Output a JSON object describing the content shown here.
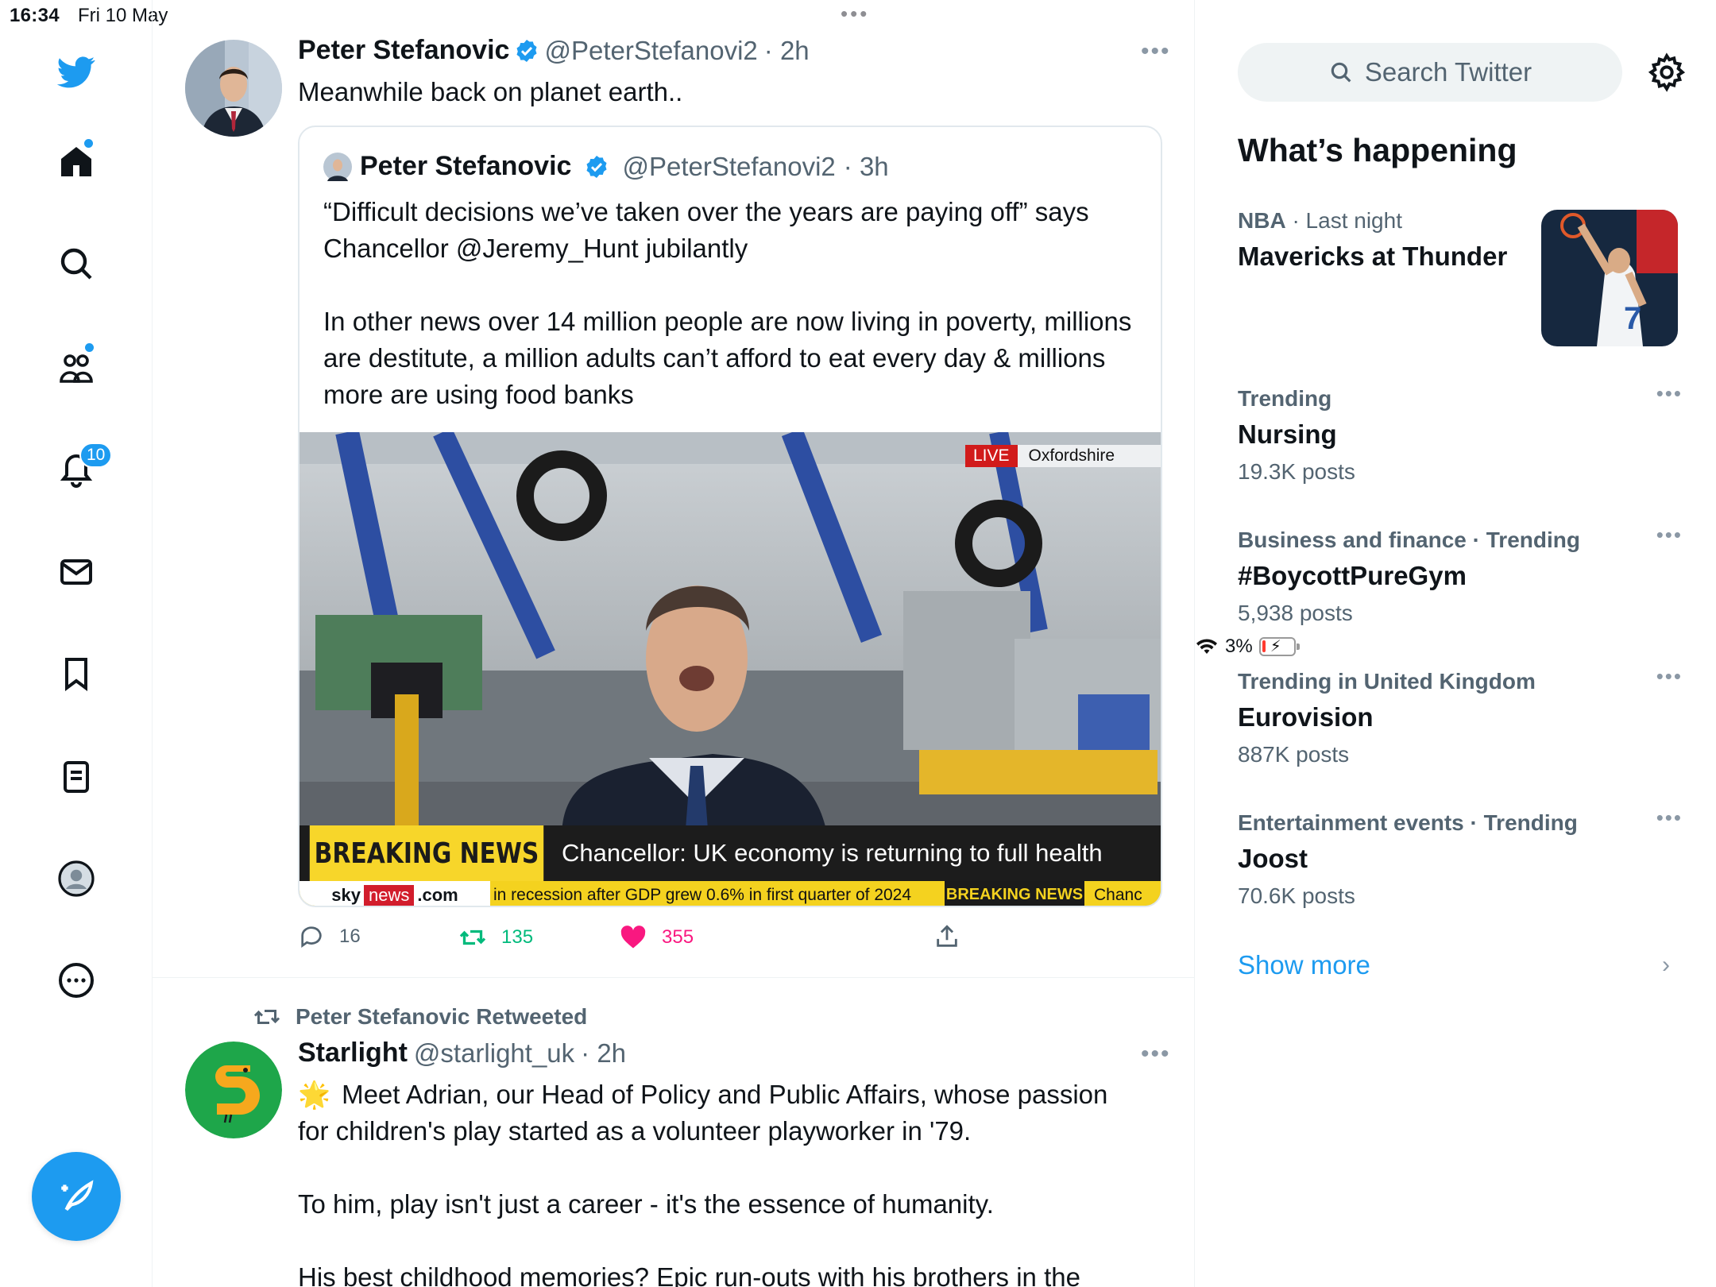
{
  "status_bar": {
    "time": "16:34",
    "date": "Fri 10 May",
    "battery": "3%"
  },
  "nav": {
    "notifications_badge": "10"
  },
  "timeline": {
    "tweet1": {
      "name": "Peter Stefanovic",
      "handle": "@PeterStefanovi2",
      "time": "· 2h",
      "text": "Meanwhile back on planet earth..",
      "quote": {
        "name": "Peter Stefanovic",
        "handle": "@PeterStefanovi2",
        "time": "· 3h",
        "text": "“Difficult decisions we’ve taken over the years are paying off” says Chancellor @Jeremy_Hunt jubilantly\n\nIn other news over 14 million people are now living in poverty, millions are destitute, a million adults can’t afford to eat every day & millions more are using food banks",
        "media": {
          "live": "LIVE",
          "location": "Oxfordshire",
          "breaking": "BREAKING NEWS",
          "headline": "Chancellor: UK economy is returning to full health",
          "logo_sky": "sky",
          "logo_news": "news",
          "logo_com": ".com",
          "ticker": "in recession after GDP grew 0.6% in first quarter of 2024",
          "ticker_tag": "BREAKING NEWS",
          "ticker_tail": "Chanc"
        }
      },
      "actions": {
        "replies": "16",
        "retweets": "135",
        "likes": "355"
      }
    },
    "tweet2": {
      "retweeted_by": "Peter Stefanovic Retweeted",
      "name": "Starlight",
      "handle": "@starlight_uk",
      "time": "· 2h",
      "emoji": "🌟",
      "line1": "Meet Adrian, our Head of Policy and Public Affairs, whose passion",
      "line2": "for children's play started as a volunteer playworker in '79.",
      "para2": "To him, play isn't just a career - it's the essence of humanity.",
      "para3": "His best childhood memories? Epic run-outs with his brothers in the"
    }
  },
  "sidebar": {
    "search_placeholder": "Search Twitter",
    "whats_happening": "What’s happening",
    "featured": {
      "meta1": "NBA",
      "meta2": "· Last night",
      "title": "Mavericks at Thunder",
      "jersey_number": "7"
    },
    "trends": [
      {
        "meta": "Trending",
        "title": "Nursing",
        "count": "19.3K posts"
      },
      {
        "meta": "Business and finance · Trending",
        "title": "#BoycottPureGym",
        "count": "5,938 posts"
      },
      {
        "meta": "Trending in United Kingdom",
        "title": "Eurovision",
        "count": "887K posts"
      },
      {
        "meta": "Entertainment events · Trending",
        "title": "Joost",
        "count": "70.6K posts"
      }
    ],
    "show_more": "Show more"
  },
  "colors": {
    "accent": "#1d9bf0",
    "like": "#f91880",
    "retweet": "#00ba7c",
    "text": "#0f1419",
    "muted": "#536471"
  }
}
